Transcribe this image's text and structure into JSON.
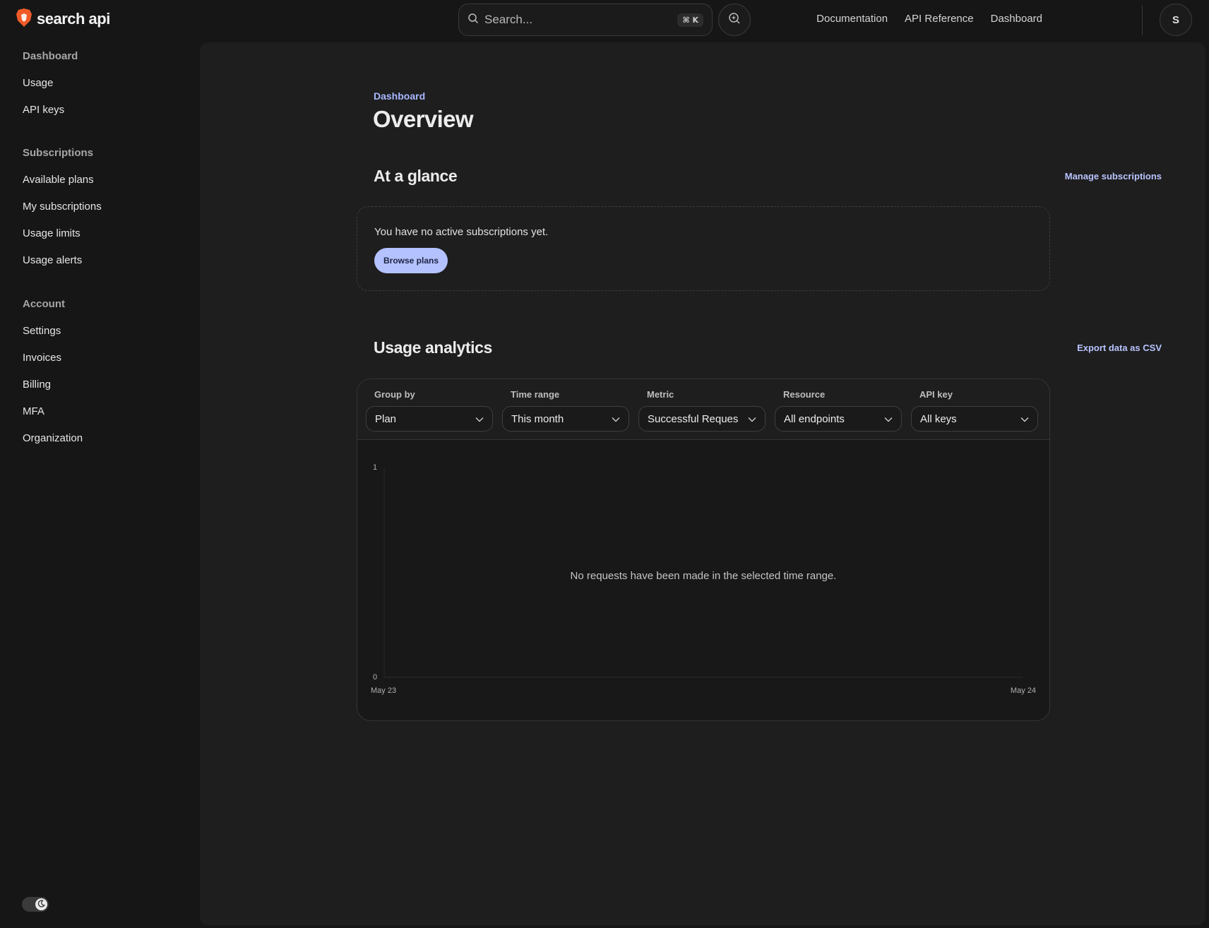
{
  "app": {
    "brand": "search api",
    "brand_accent": "#f05a28"
  },
  "search": {
    "placeholder": "Search...",
    "shortcut": "⌘ K"
  },
  "topnav": {
    "documentation": "Documentation",
    "api_reference": "API Reference",
    "dashboard": "Dashboard"
  },
  "user": {
    "initial": "S"
  },
  "sidebar": {
    "groups": [
      {
        "title": "Dashboard",
        "items": [
          "Usage",
          "API keys"
        ]
      },
      {
        "title": "Subscriptions",
        "items": [
          "Available plans",
          "My subscriptions",
          "Usage limits",
          "Usage alerts"
        ]
      },
      {
        "title": "Account",
        "items": [
          "Settings",
          "Invoices",
          "Billing",
          "MFA",
          "Organization"
        ]
      }
    ]
  },
  "page": {
    "breadcrumb": "Dashboard",
    "title": "Overview"
  },
  "glance": {
    "title": "At a glance",
    "link": "Manage subscriptions",
    "message": "You have no active subscriptions yet.",
    "button": "Browse plans"
  },
  "analytics": {
    "title": "Usage analytics",
    "link": "Export data as CSV",
    "filters": [
      {
        "label": "Group by",
        "value": "Plan"
      },
      {
        "label": "Time range",
        "value": "This month"
      },
      {
        "label": "Metric",
        "value": "Successful Reques"
      },
      {
        "label": "Resource",
        "value": "All endpoints"
      },
      {
        "label": "API key",
        "value": "All keys"
      }
    ],
    "empty_message": "No requests have been made in the selected time range."
  },
  "colors": {
    "accent_link": "#b8c4ff",
    "button_bg": "#b4c2ff",
    "panel_bg": "#1e1e1e"
  },
  "chart_data": {
    "type": "line",
    "x": [
      "May 23",
      "May 24"
    ],
    "series": [],
    "ylim": [
      0,
      1
    ],
    "y_ticks": [
      "0",
      "1"
    ],
    "x_ticks": [
      "May 23",
      "May 24"
    ],
    "grid": false
  }
}
